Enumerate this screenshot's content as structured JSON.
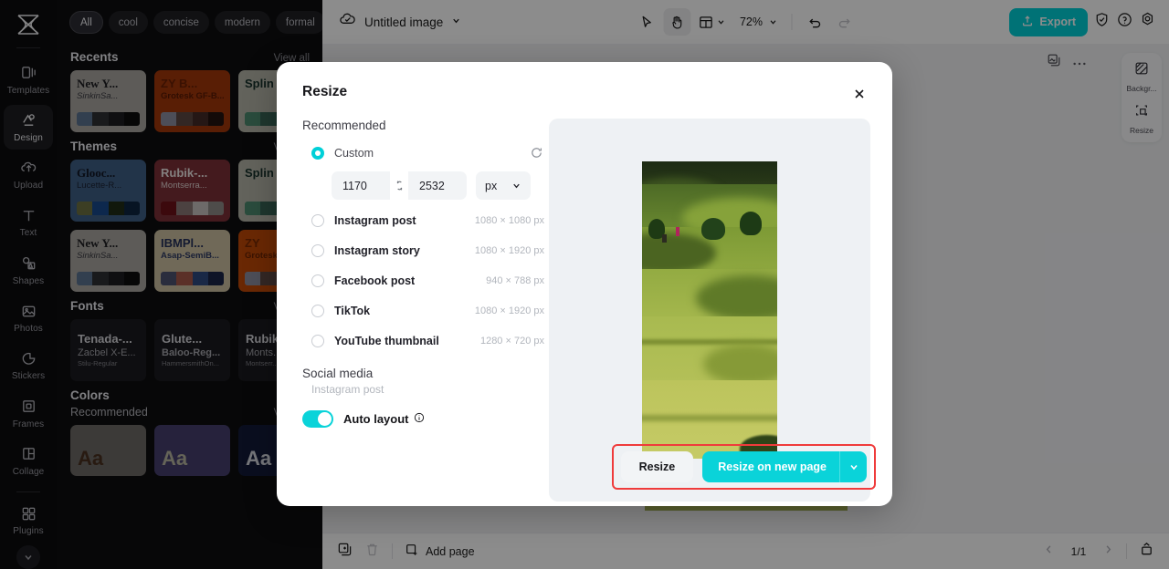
{
  "app": {
    "logo_name": "capcut-logo"
  },
  "rail": {
    "items": [
      {
        "label": "Templates",
        "icon": "templates-icon",
        "active": false
      },
      {
        "label": "Design",
        "icon": "design-icon",
        "active": true
      },
      {
        "label": "Upload",
        "icon": "upload-icon",
        "active": false
      },
      {
        "label": "Text",
        "icon": "text-icon",
        "active": false
      },
      {
        "label": "Shapes",
        "icon": "shapes-icon",
        "active": false
      },
      {
        "label": "Photos",
        "icon": "photos-icon",
        "active": false
      },
      {
        "label": "Stickers",
        "icon": "stickers-icon",
        "active": false
      },
      {
        "label": "Frames",
        "icon": "frames-icon",
        "active": false
      },
      {
        "label": "Collage",
        "icon": "collage-icon",
        "active": false
      },
      {
        "label": "Plugins",
        "icon": "plugins-icon",
        "active": false
      }
    ]
  },
  "panel": {
    "chips": [
      "All",
      "cool",
      "concise",
      "modern",
      "formal"
    ],
    "sections": {
      "recents": {
        "title": "Recents",
        "link": "View all"
      },
      "themes": {
        "title": "Themes",
        "link": "View all"
      },
      "fonts": {
        "title": "Fonts",
        "link": "View all"
      },
      "colors": {
        "title": "Colors",
        "sub": "Recommended",
        "link": "View all"
      }
    },
    "recents": [
      {
        "t1": "New Y...",
        "t2": "SinkinSa...",
        "bg": "#a9a6a1",
        "c1": "#5b7390",
        "c2": "#2f3033",
        "c3": "#1d1d1f",
        "c4": "#0d0d0e"
      },
      {
        "t1": "ZY B...",
        "t2": "Grotesk GF-B...",
        "bg": "#a2380a",
        "c1": "#8d8ea0",
        "c2": "#5e4742",
        "c3": "#442b27",
        "c4": "#231310"
      },
      {
        "t1": "Splin ZY Al",
        "t2": "",
        "bg": "#b4b5a8",
        "c1": "#4e8a70",
        "c2": "#376355",
        "c3": "#2d5048",
        "c4": "#22403a"
      }
    ],
    "themes": [
      {
        "t1": "Glooc...",
        "t2": "Lucette-R...",
        "bg": "#3f5f85",
        "c1": "#6e7242",
        "c2": "#184a8c",
        "c3": "#1f2d16",
        "c4": "#0e2640"
      },
      {
        "t1": "Rubik-...",
        "t2": "Montserra...",
        "bg": "#7d3138",
        "c1": "#6e1118",
        "c2": "#8a7877",
        "c3": "#c6c2bf",
        "c4": "#8e8a88"
      },
      {
        "t1": "Splin ZY Al",
        "t2": "",
        "bg": "#b4b5a8",
        "c1": "#4e8a70",
        "c2": "#376355",
        "c3": "#2d5048",
        "c4": "#22403a"
      },
      {
        "t1": "New Y...",
        "t2": "SinkinSa...",
        "bg": "#a9a6a1",
        "c1": "#5b7390",
        "c2": "#2f3033",
        "c3": "#1d1d1f",
        "c4": "#0d0d0e"
      },
      {
        "t1": "IBMPl...",
        "t2": "Asap-SemiB...",
        "bg": "#ccc0a1",
        "c1": "#4d5270",
        "c2": "#a7584a",
        "c3": "#2e4a80",
        "c4": "#1b2647"
      },
      {
        "t1": "ZY",
        "t2": "Grotesk",
        "bg": "#c14a08",
        "c1": "#8d8ea0",
        "c2": "#5e4742",
        "c3": "#442b27",
        "c4": "#231310"
      }
    ],
    "fonts": [
      {
        "t1": "Tenada-...",
        "t2": "Zacbel X-E...",
        "t3": "Stilu-Regular"
      },
      {
        "t1": "Glute...",
        "t2": "Baloo-Reg...",
        "t3": "HammersmithOn..."
      },
      {
        "t1": "Rubik",
        "t2": "Monts...",
        "t3": "Montserr..."
      }
    ],
    "colors": [
      {
        "label": "Aa",
        "bg": "#6d6a66",
        "fg": "#4a3020"
      },
      {
        "label": "Aa",
        "bg": "#453f6e",
        "fg": "#b9b6a0"
      },
      {
        "label": "Aa",
        "bg": "#131a3a",
        "fg": "#d6d8de"
      }
    ]
  },
  "topbar": {
    "cloud_icon": "cloud-saved-icon",
    "title": "Untitled image",
    "title_caret": "chevron-down-icon",
    "tools": [
      {
        "name": "cursor-tool",
        "icon": "cursor-icon",
        "active": false
      },
      {
        "name": "hand-tool",
        "icon": "hand-icon",
        "active": true
      },
      {
        "name": "layout-tool",
        "icon": "layout-icon",
        "active": false
      }
    ],
    "zoom": "72%",
    "undo_icon": "undo-icon",
    "redo_icon": "redo-icon",
    "export_label": "Export",
    "export_icon": "export-icon",
    "right_icons": [
      "shield-icon",
      "help-icon",
      "settings-icon"
    ]
  },
  "canvas": {
    "tool_icons": [
      "duplicate-image-icon",
      "more-options-icon"
    ],
    "dock": [
      {
        "label": "Backgr...",
        "icon": "background-icon"
      },
      {
        "label": "Resize",
        "icon": "resize-icon"
      }
    ]
  },
  "bottombar": {
    "duplicate_icon": "duplicate-page-icon",
    "delete_icon": "delete-page-icon",
    "add_page_label": "Add page",
    "add_page_icon": "add-page-icon",
    "prev_icon": "chevron-left-icon",
    "next_icon": "chevron-right-icon",
    "page_indicator": "1/1",
    "grid_icon": "page-grid-icon"
  },
  "modal": {
    "title": "Resize",
    "close_icon": "close-icon",
    "recommended_label": "Recommended",
    "refresh_icon": "refresh-icon",
    "options": [
      {
        "label": "Custom",
        "dim": "",
        "selected": true
      },
      {
        "label": "Instagram post",
        "dim": "1080 × 1080 px",
        "selected": false
      },
      {
        "label": "Instagram story",
        "dim": "1080 × 1920 px",
        "selected": false
      },
      {
        "label": "Facebook post",
        "dim": "940 × 788 px",
        "selected": false
      },
      {
        "label": "TikTok",
        "dim": "1080 × 1920 px",
        "selected": false
      },
      {
        "label": "YouTube thumbnail",
        "dim": "1280 × 720 px",
        "selected": false
      }
    ],
    "custom": {
      "width": "1170",
      "height": "2532",
      "link_icon": "link-dimensions-icon",
      "unit": "px",
      "unit_caret": "chevron-down-icon"
    },
    "social_media_label": "Social media",
    "social_media_value": "Instagram post",
    "auto_layout_label": "Auto layout",
    "auto_layout_info_icon": "info-icon",
    "auto_layout_on": true,
    "secondary_button": "Resize",
    "primary_button": "Resize on new page",
    "primary_caret": "chevron-down-icon",
    "highlight_color": "#ef3b3b"
  },
  "colors": {
    "accent": "#0ad3d9",
    "panel_bg": "#0e0e10",
    "rail_bg": "#0b0b0d",
    "modal_bg": "#ffffff",
    "scrim": "rgba(0,0,0,0.45)"
  }
}
